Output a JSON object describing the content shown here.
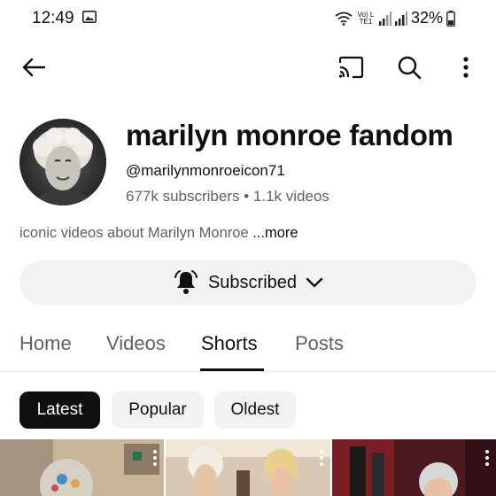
{
  "status_bar": {
    "time": "12:49",
    "carrier": "Vo) LTE1",
    "battery_percent": "32%"
  },
  "app_bar": {
    "back_icon": "arrow-left-icon",
    "cast_icon": "cast-icon",
    "search_icon": "search-icon",
    "more_icon": "more-vertical-icon"
  },
  "channel": {
    "title": "marilyn monroe fandom",
    "handle": "@marilynmonroeicon71",
    "subscribers": "677k subscribers",
    "separator": " • ",
    "videos": "1.1k videos",
    "description": "iconic videos about Marilyn Monroe ",
    "more": "...more"
  },
  "subscribe_button": {
    "label": "Subscribed",
    "bell_icon": "bell-icon",
    "chevron_icon": "chevron-down-icon"
  },
  "tabs": [
    {
      "label": "Home"
    },
    {
      "label": "Videos"
    },
    {
      "label": "Shorts"
    },
    {
      "label": "Posts"
    }
  ],
  "active_tab": "Shorts",
  "chips": [
    {
      "label": "Latest"
    },
    {
      "label": "Popular"
    },
    {
      "label": "Oldest"
    }
  ],
  "active_chip": "Latest",
  "colors": {
    "text_primary": "#0f0f0f",
    "text_secondary": "#606060",
    "chip_bg": "#f2f2f2",
    "chip_active_bg": "#0f0f0f"
  }
}
